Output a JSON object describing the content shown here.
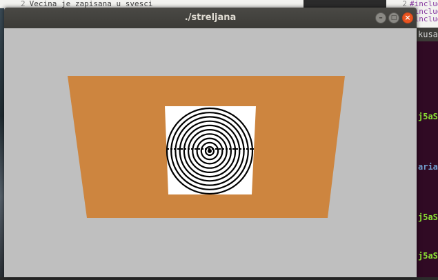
{
  "background": {
    "left_editor_line_number": "2",
    "left_editor_text": "Vecina je zapisana u svesci",
    "right_editor_lines": [
      {
        "num": "2",
        "text": "#includ"
      },
      {
        "num": "",
        "text": "#includ"
      },
      {
        "num": "",
        "text": "#includ"
      }
    ],
    "terminal_title": "kusa",
    "terminal_lines": [
      "j5aS",
      "aria",
      "j5aS",
      "j5aS"
    ]
  },
  "window": {
    "title": "./streljana",
    "minimize_label": "–",
    "maximize_label": "□",
    "close_label": "×"
  },
  "scene": {
    "background_color": "#bfbfbf",
    "floor_color": "#cd853f",
    "target_backing_color": "#ffffff",
    "target_ring_color": "#000000",
    "target_ring_count": 10
  }
}
